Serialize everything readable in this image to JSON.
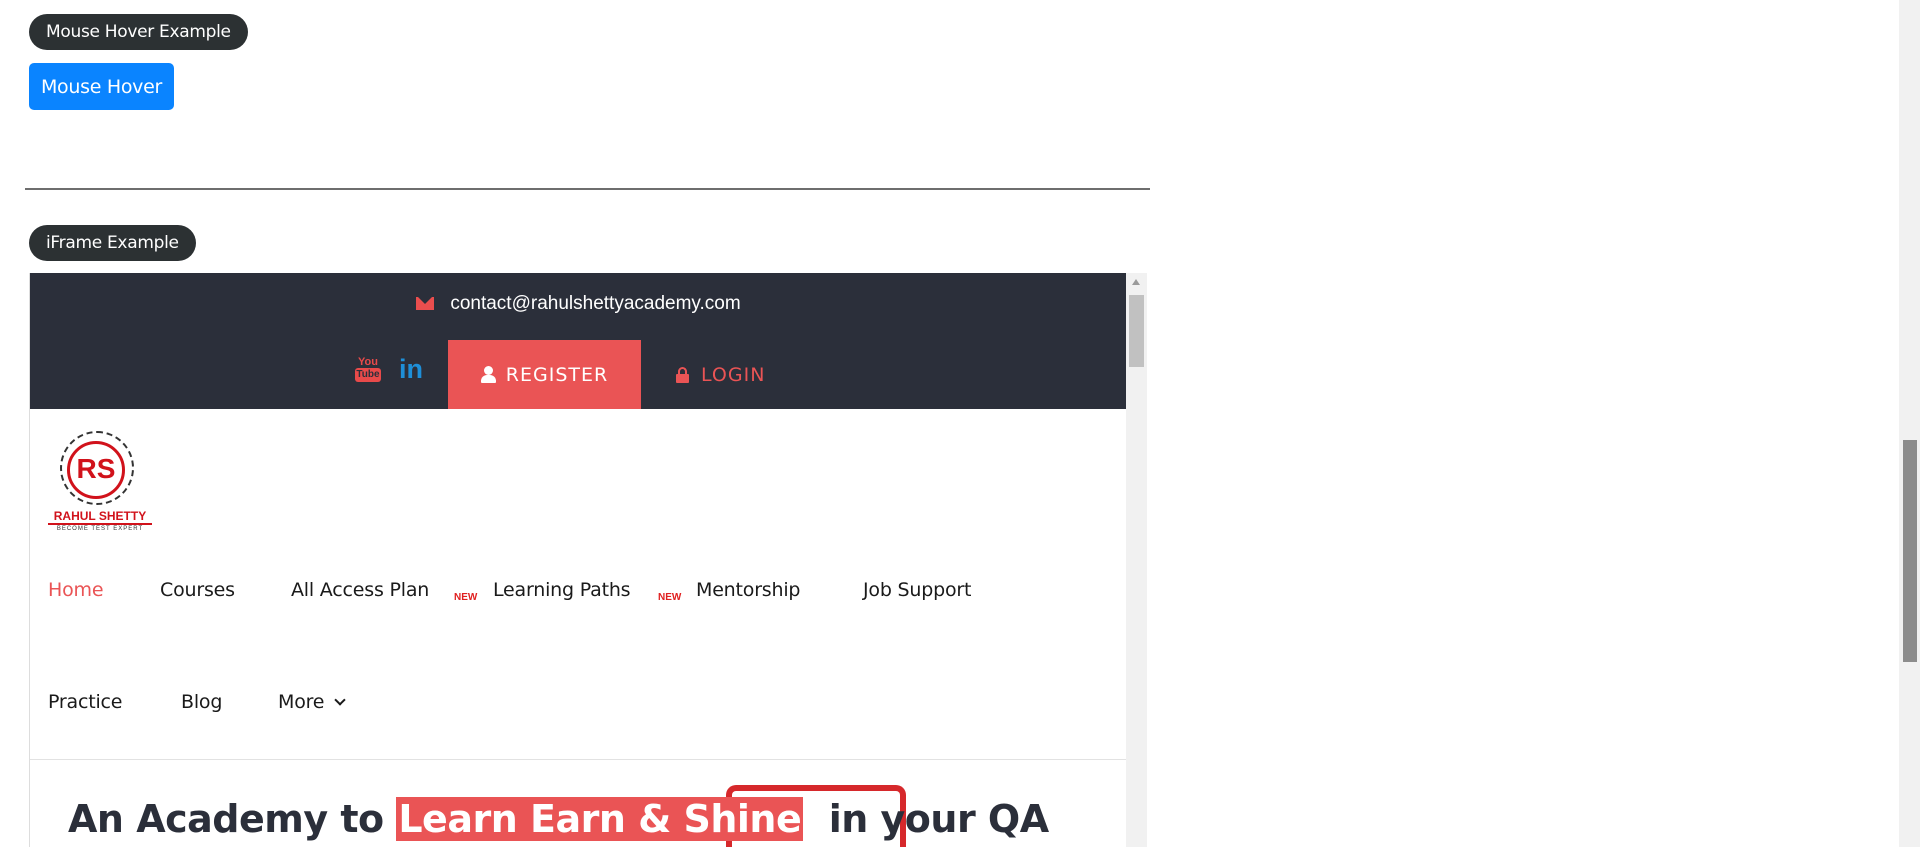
{
  "hover_section": {
    "badge": "Mouse Hover Example",
    "button_label": "Mouse Hover"
  },
  "iframe_section": {
    "badge": "iFrame Example"
  },
  "iframe_page": {
    "contact_email": "contact@rahulshettyacademy.com",
    "social": {
      "youtube_top": "You",
      "youtube_bottom": "Tube",
      "linkedin": "in"
    },
    "register_label": "REGISTER",
    "login_label": "LOGIN",
    "logo": {
      "monogram": "RS",
      "name": "RAHUL SHETTY",
      "tagline": "BECOME TEST EXPERT"
    },
    "nav": {
      "home": "Home",
      "courses": "Courses",
      "all_access": "All Access Plan",
      "all_access_tag": "NEW",
      "learning_paths": "Learning Paths",
      "learning_paths_tag": "NEW",
      "mentorship": "Mentorship",
      "job_support": "Job Support",
      "practice": "Practice",
      "blog": "Blog",
      "more": "More"
    },
    "hero": {
      "prefix": "An Academy to ",
      "highlight": "Learn Earn & Shine",
      "suffix": "  in your QA"
    }
  },
  "colors": {
    "accent_red": "#ea5455",
    "primary_blue": "#0a84ff",
    "topbar_dark": "#2b2f3a",
    "badge_dark": "#2c3133"
  }
}
